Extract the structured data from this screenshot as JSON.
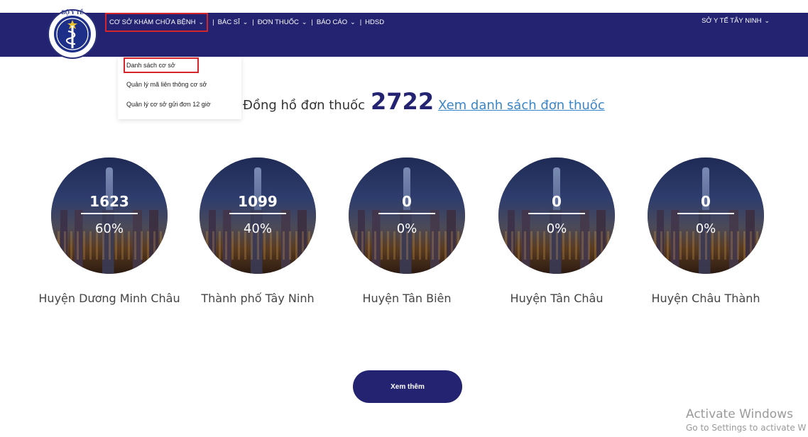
{
  "header": {
    "logo_text_top": "BỘ Y TẾ",
    "logo_text_bottom": "MINISTRY OF HEALTH",
    "nav": [
      {
        "label": "CƠ SỞ KHÁM CHỮA BỆNH",
        "chevron": "chevron-down-icon",
        "active": true
      },
      {
        "label": "BÁC SĨ",
        "chevron": "chevron-down-icon"
      },
      {
        "label": "ĐƠN THUỐC",
        "chevron": "chevron-down-icon"
      },
      {
        "label": "BÁO CÁO",
        "chevron": "chevron-down-icon"
      },
      {
        "label": "HDSD"
      }
    ],
    "separator": "|",
    "account": "SỞ Y TẾ TÂY NINH",
    "bg_color": "#232372",
    "highlight_color": "#d6252a"
  },
  "dropdown": {
    "items": [
      "Danh sách cơ sở",
      "Quản lý mã liên thông cơ sở",
      "Quản lý cơ sở gửi đơn 12 giờ"
    ]
  },
  "counter": {
    "label": "Đồng hồ đơn thuốc",
    "value": "2722",
    "link": "Xem danh sách đơn thuốc"
  },
  "districts": [
    {
      "count": "1623",
      "percent": "60%",
      "name": "Huyện Dương Minh Châu"
    },
    {
      "count": "1099",
      "percent": "40%",
      "name": "Thành phố Tây Ninh"
    },
    {
      "count": "0",
      "percent": "0%",
      "name": "Huyện Tân Biên"
    },
    {
      "count": "0",
      "percent": "0%",
      "name": "Huyện Tân Châu"
    },
    {
      "count": "0",
      "percent": "0%",
      "name": "Huyện Châu Thành"
    }
  ],
  "more_button": "Xem thêm",
  "watermark": {
    "line1": "Activate Windows",
    "line2": "Go to Settings to activate W"
  }
}
